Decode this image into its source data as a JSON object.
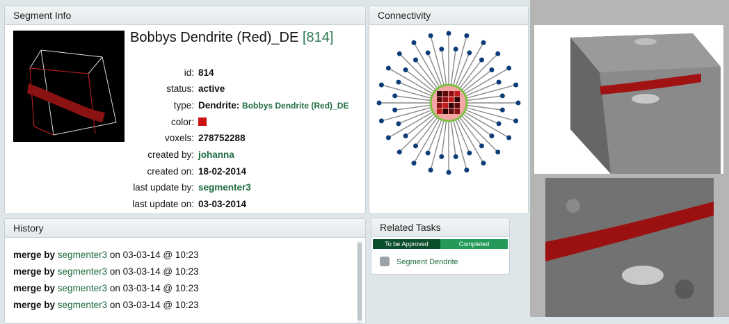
{
  "segment_info": {
    "header": "Segment Info",
    "title_name": "Bobbys Dendrite (Red)_DE",
    "title_id_open": "[",
    "title_id": "814",
    "title_id_close": "]",
    "rows": [
      {
        "label": "id:",
        "value": "814"
      },
      {
        "label": "status:",
        "value": "active"
      },
      {
        "label": "type:",
        "value": "Dendrite:",
        "extra": "Bobbys Dendrite (Red)_DE"
      },
      {
        "label": "color:",
        "value": ""
      },
      {
        "label": "voxels:",
        "value": "278752288"
      },
      {
        "label": "created by:",
        "value": "johanna"
      },
      {
        "label": "created on:",
        "value": "18-02-2014"
      },
      {
        "label": "last update by:",
        "value": "segmenter3"
      },
      {
        "label": "last update on:",
        "value": "03-03-2014"
      }
    ],
    "segment_color": "#cc1111"
  },
  "connectivity": {
    "header": "Connectivity",
    "node_color": "#0d3d78",
    "center_color": "#f4a6a6",
    "ring_color": "#7cc242"
  },
  "history": {
    "header": "History",
    "entries": [
      {
        "action": "merge by",
        "user": "segmenter3",
        "when": "on 03-03-14 @ 10:23"
      },
      {
        "action": "merge by",
        "user": "segmenter3",
        "when": "on 03-03-14 @ 10:23"
      },
      {
        "action": "merge by",
        "user": "segmenter3",
        "when": "on 03-03-14 @ 10:23"
      },
      {
        "action": "merge by",
        "user": "segmenter3",
        "when": "on 03-03-14 @ 10:23"
      }
    ]
  },
  "related_tasks": {
    "header": "Related Tasks",
    "tabs": [
      "To be Approved",
      "Completed"
    ],
    "items": [
      "Segment Dendrite"
    ]
  }
}
